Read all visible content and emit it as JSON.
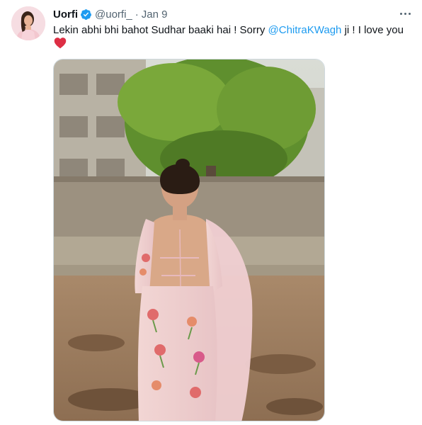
{
  "tweet": {
    "author_name": "Uorfi",
    "handle": "@uorfi_",
    "separator": "·",
    "date": "Jan 9",
    "text_before": "Lekin abhi bhi bahot Sudhar baaki hai ! Sorry ",
    "mention": "@ChitraKWagh",
    "text_after": " ji ! I love you"
  },
  "icons": {
    "verified": "verified-badge-icon",
    "more": "more-options-icon",
    "heart": "red-heart-emoji"
  },
  "colors": {
    "link": "#1d9bf0",
    "secondary_text": "#536471",
    "heart": "#e0245e"
  }
}
